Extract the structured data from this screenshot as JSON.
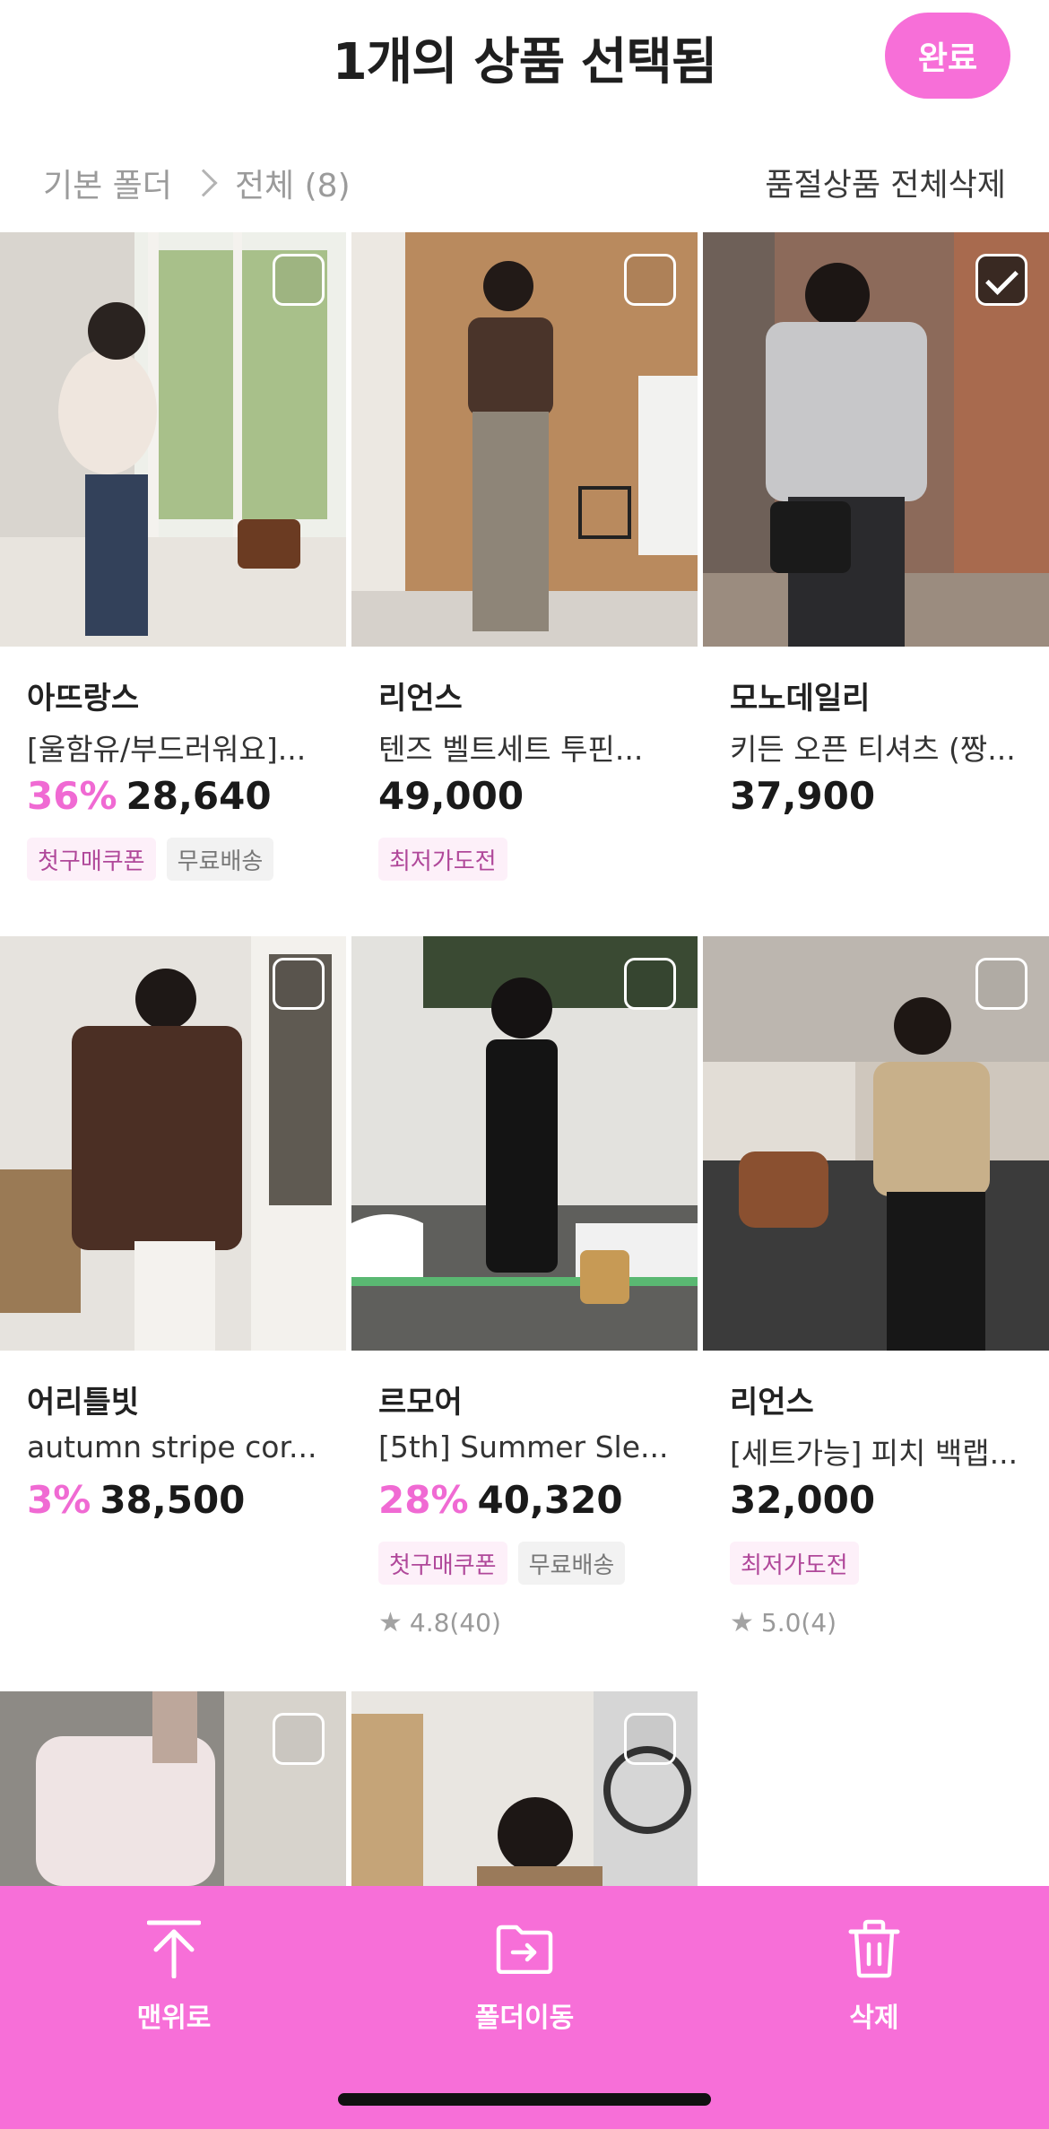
{
  "header": {
    "title": "1개의 상품 선택됨",
    "done_label": "완료"
  },
  "breadcrumb": {
    "root": "기본 폴더",
    "current": "전체 (8)",
    "delete_soldout": "품절상품 전체삭제"
  },
  "colors": {
    "accent": "#f76fd8",
    "discount": "#f06ad3"
  },
  "products": [
    {
      "brand": "아뜨랑스",
      "name": "[울함유/부드러워요]...",
      "discount": "36%",
      "price": "28,640",
      "tags": [
        "첫구매쿠폰",
        "무료배송"
      ],
      "rating": "",
      "selected": false
    },
    {
      "brand": "리언스",
      "name": "텐즈 벨트세트 투핀...",
      "discount": "",
      "price": "49,000",
      "tags": [
        "최저가도전"
      ],
      "rating": "",
      "selected": false
    },
    {
      "brand": "모노데일리",
      "name": "키든 오픈 티셔츠 (짱...",
      "discount": "",
      "price": "37,900",
      "tags": [],
      "rating": "",
      "selected": true
    },
    {
      "brand": "어리틀빗",
      "name": "autumn stripe cor...",
      "discount": "3%",
      "price": "38,500",
      "tags": [],
      "rating": "",
      "selected": false
    },
    {
      "brand": "르모어",
      "name": "[5th] Summer Sle...",
      "discount": "28%",
      "price": "40,320",
      "tags": [
        "첫구매쿠폰",
        "무료배송"
      ],
      "rating": "4.8(40)",
      "selected": false
    },
    {
      "brand": "리언스",
      "name": "[세트가능] 피치 백랩...",
      "discount": "",
      "price": "32,000",
      "tags": [
        "최저가도전"
      ],
      "rating": "5.0(4)",
      "selected": false
    },
    {
      "brand": "",
      "name": "",
      "discount": "",
      "price": "",
      "tags": [],
      "rating": "",
      "selected": false
    },
    {
      "brand": "",
      "name": "",
      "discount": "",
      "price": "",
      "tags": [],
      "rating": "",
      "selected": false
    }
  ],
  "bottom_bar": {
    "top_label": "맨위로",
    "move_label": "폴더이동",
    "delete_label": "삭제"
  }
}
